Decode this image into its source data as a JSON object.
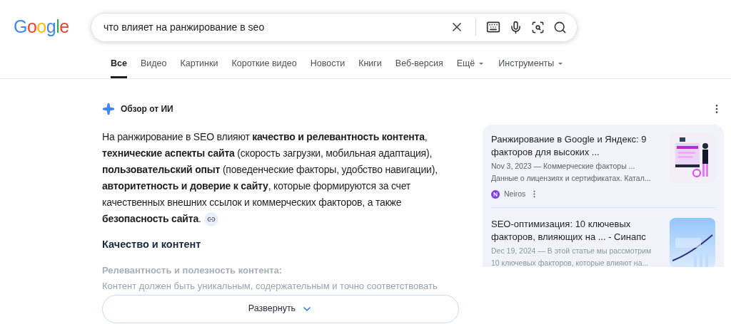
{
  "logo": "Google",
  "search": {
    "value": "что влияет на ранжирование в seo"
  },
  "tabs": [
    {
      "label": "Все",
      "selected": true,
      "dropdown": false
    },
    {
      "label": "Видео",
      "selected": false,
      "dropdown": false
    },
    {
      "label": "Картинки",
      "selected": false,
      "dropdown": false
    },
    {
      "label": "Короткие видео",
      "selected": false,
      "dropdown": false
    },
    {
      "label": "Новости",
      "selected": false,
      "dropdown": false
    },
    {
      "label": "Книги",
      "selected": false,
      "dropdown": false
    },
    {
      "label": "Веб-версия",
      "selected": false,
      "dropdown": false
    },
    {
      "label": "Ещё",
      "selected": false,
      "dropdown": true
    },
    {
      "label": "Инструменты",
      "selected": false,
      "dropdown": true
    }
  ],
  "ai_overview": {
    "title": "Обзор от ИИ",
    "summary": "На ранжирование в SEO влияют **качество и релевантность контента**, **технические аспекты сайта** (скорость загрузки, мобильная адаптация), **пользовательский опыт** (поведенческие факторы, удобство навигации), **авторитетность и доверие к сайту**, которые формируются за счет качественных внешних ссылок и коммерческих факторов, а также **безопасность сайта**.",
    "heading": "Качество и контент",
    "subheading": "Релевантность и полезность контента:",
    "faded_text": "Контент должен быть уникальным, содержательным и точно соответствовать",
    "expand_button": "Развернуть",
    "sources": [
      {
        "title": "Ранжирование в Google и Яндекс: 9 факторов для высоких ...",
        "snippet_1": "Nov 3, 2023 — Коммерческие факторы ...",
        "snippet_2": "Данные о лицензиях и сертификатах. Катал...",
        "site": "Neiros",
        "faded": false
      },
      {
        "title": "SEO-оптимизация: 10 ключевых факторов, влияющих на ... - Синапс",
        "snippet_1": "Dec 19, 2024 — В этой статье мы рассмотрим",
        "snippet_2": "10 ключевых факторов, которые влияют на...",
        "faded": true
      }
    ]
  }
}
